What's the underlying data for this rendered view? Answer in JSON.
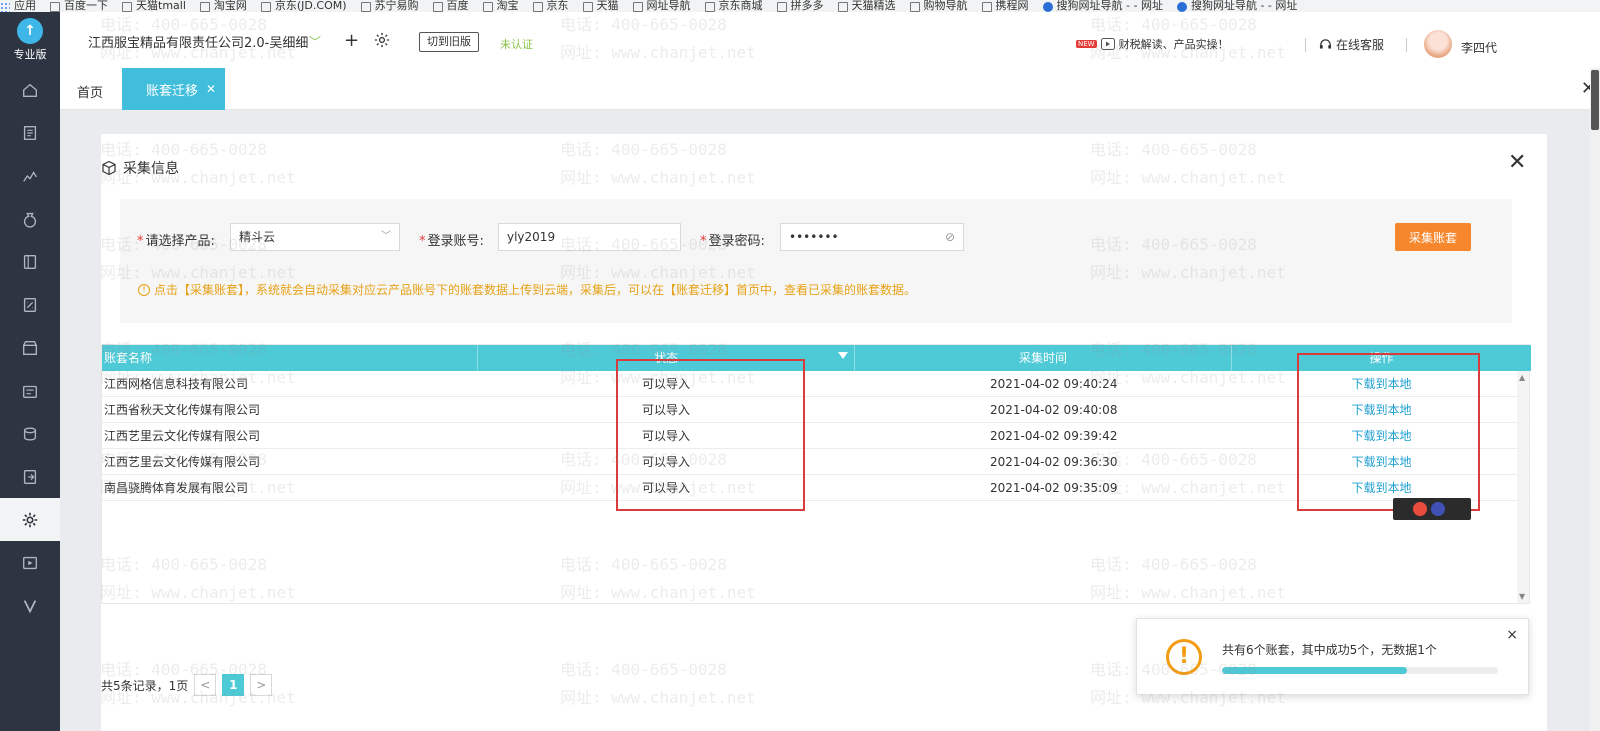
{
  "bookmarks": [
    {
      "label": "应用",
      "icon": "apps-icon"
    },
    {
      "label": "百度一下",
      "icon": "bookmark-icon"
    },
    {
      "label": "天猫tmall",
      "icon": "bookmark-icon"
    },
    {
      "label": "淘宝网",
      "icon": "bookmark-icon"
    },
    {
      "label": "京东(JD.COM)",
      "icon": "bookmark-icon"
    },
    {
      "label": "苏宁易购",
      "icon": "bookmark-icon"
    },
    {
      "label": "百度",
      "icon": "bookmark-icon"
    },
    {
      "label": "淘宝",
      "icon": "bookmark-icon"
    },
    {
      "label": "京东",
      "icon": "bookmark-icon"
    },
    {
      "label": "天猫",
      "icon": "bookmark-icon"
    },
    {
      "label": "网址导航",
      "icon": "bookmark-icon"
    },
    {
      "label": "京东商城",
      "icon": "bookmark-icon"
    },
    {
      "label": "拼多多",
      "icon": "bookmark-icon"
    },
    {
      "label": "天猫精选",
      "icon": "bookmark-icon"
    },
    {
      "label": "购物导航",
      "icon": "bookmark-icon"
    },
    {
      "label": "携程网",
      "icon": "bookmark-icon"
    },
    {
      "label": "搜狗网址导航 - - 网址",
      "icon": "sogou-icon"
    },
    {
      "label": "搜狗网址导航 - - 网址",
      "icon": "sogou-icon"
    }
  ],
  "sidebar": {
    "logo_text": "专业版",
    "items": [
      {
        "name": "home",
        "icon": "home-icon"
      },
      {
        "name": "voucher",
        "icon": "voucher-icon"
      },
      {
        "name": "report",
        "icon": "chart-icon"
      },
      {
        "name": "money",
        "icon": "money-bag-icon"
      },
      {
        "name": "ledger",
        "icon": "ledger-icon"
      },
      {
        "name": "tax",
        "icon": "tax-icon"
      },
      {
        "name": "store",
        "icon": "store-icon"
      },
      {
        "name": "cashier",
        "icon": "cashier-icon"
      },
      {
        "name": "coins",
        "icon": "coins-icon"
      },
      {
        "name": "export",
        "icon": "export-icon"
      },
      {
        "name": "settings",
        "icon": "gear-icon",
        "active": true
      },
      {
        "name": "video",
        "icon": "video-icon"
      },
      {
        "name": "v-logo",
        "icon": "v-icon"
      }
    ]
  },
  "header": {
    "company": "江西服宝精品有限责任公司2.0-吴细细",
    "switch_label": "切到旧版",
    "status": "未认证",
    "news_tag": "NEW",
    "news_text": "财税解读、产品实操！",
    "service": "在线客服",
    "username": "李四代"
  },
  "tabs": {
    "home": "首页",
    "active": "账套迁移"
  },
  "panel": {
    "title": "采集信息",
    "form": {
      "product_label": "请选择产品:",
      "product_value": "精斗云",
      "account_label": "登录账号:",
      "account_value": "yly2019",
      "password_label": "登录密码:",
      "password_value": "•••••••",
      "collect_button": "采集账套",
      "tip": "点击【采集账套】，系统就会自动采集对应云产品账号下的账套数据上传到云端，采集后，可以在【账套迁移】首页中，查看已采集的账套数据。"
    },
    "table": {
      "columns": [
        "账套名称",
        "状态",
        "采集时间",
        "操作"
      ],
      "rows": [
        {
          "name": "江西网格信息科技有限公司",
          "status": "可以导入",
          "time": "2021-04-02 09:40:24",
          "action": "下载到本地"
        },
        {
          "name": "江西省秋天文化传媒有限公司",
          "status": "可以导入",
          "time": "2021-04-02 09:40:08",
          "action": "下载到本地"
        },
        {
          "name": "江西艺里云文化传媒有限公司",
          "status": "可以导入",
          "time": "2021-04-02 09:39:42",
          "action": "下载到本地"
        },
        {
          "name": "江西艺里云文化传媒有限公司",
          "status": "可以导入",
          "time": "2021-04-02 09:36:30",
          "action": "下载到本地"
        },
        {
          "name": "南昌骁腾体育发展有限公司",
          "status": "可以导入",
          "time": "2021-04-02 09:35:09",
          "action": "下载到本地"
        }
      ]
    },
    "pager": {
      "summary": "共5条记录，1页",
      "prev": "<",
      "current": "1",
      "next": ">"
    }
  },
  "toast": {
    "message": "共有6个账套，其中成功5个，无数据1个",
    "progress": 0.67,
    "close": "×"
  },
  "watermark": {
    "phone": "电话: 400-665-0028",
    "site": "网址: www.chanjet.net"
  },
  "colors": {
    "accent": "#41bedb",
    "table_header": "#4ec9d6",
    "sidebar": "#2d3442",
    "orange": "#f7872d",
    "tip": "#e6a116",
    "highlight": "#d93c3c"
  }
}
